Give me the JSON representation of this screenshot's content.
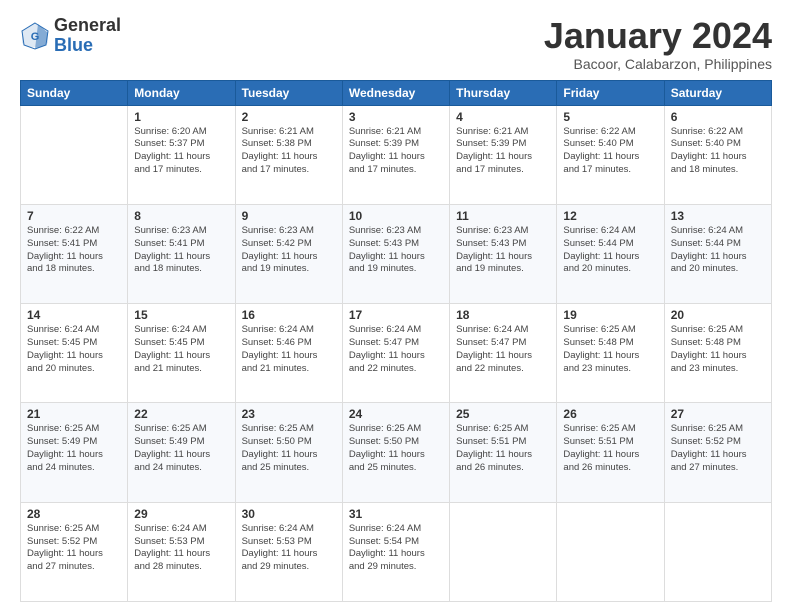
{
  "logo": {
    "general": "General",
    "blue": "Blue"
  },
  "title": "January 2024",
  "location": "Bacoor, Calabarzon, Philippines",
  "headers": [
    "Sunday",
    "Monday",
    "Tuesday",
    "Wednesday",
    "Thursday",
    "Friday",
    "Saturday"
  ],
  "weeks": [
    [
      {
        "day": "",
        "info": ""
      },
      {
        "day": "1",
        "info": "Sunrise: 6:20 AM\nSunset: 5:37 PM\nDaylight: 11 hours\nand 17 minutes."
      },
      {
        "day": "2",
        "info": "Sunrise: 6:21 AM\nSunset: 5:38 PM\nDaylight: 11 hours\nand 17 minutes."
      },
      {
        "day": "3",
        "info": "Sunrise: 6:21 AM\nSunset: 5:39 PM\nDaylight: 11 hours\nand 17 minutes."
      },
      {
        "day": "4",
        "info": "Sunrise: 6:21 AM\nSunset: 5:39 PM\nDaylight: 11 hours\nand 17 minutes."
      },
      {
        "day": "5",
        "info": "Sunrise: 6:22 AM\nSunset: 5:40 PM\nDaylight: 11 hours\nand 17 minutes."
      },
      {
        "day": "6",
        "info": "Sunrise: 6:22 AM\nSunset: 5:40 PM\nDaylight: 11 hours\nand 18 minutes."
      }
    ],
    [
      {
        "day": "7",
        "info": "Sunrise: 6:22 AM\nSunset: 5:41 PM\nDaylight: 11 hours\nand 18 minutes."
      },
      {
        "day": "8",
        "info": "Sunrise: 6:23 AM\nSunset: 5:41 PM\nDaylight: 11 hours\nand 18 minutes."
      },
      {
        "day": "9",
        "info": "Sunrise: 6:23 AM\nSunset: 5:42 PM\nDaylight: 11 hours\nand 19 minutes."
      },
      {
        "day": "10",
        "info": "Sunrise: 6:23 AM\nSunset: 5:43 PM\nDaylight: 11 hours\nand 19 minutes."
      },
      {
        "day": "11",
        "info": "Sunrise: 6:23 AM\nSunset: 5:43 PM\nDaylight: 11 hours\nand 19 minutes."
      },
      {
        "day": "12",
        "info": "Sunrise: 6:24 AM\nSunset: 5:44 PM\nDaylight: 11 hours\nand 20 minutes."
      },
      {
        "day": "13",
        "info": "Sunrise: 6:24 AM\nSunset: 5:44 PM\nDaylight: 11 hours\nand 20 minutes."
      }
    ],
    [
      {
        "day": "14",
        "info": "Sunrise: 6:24 AM\nSunset: 5:45 PM\nDaylight: 11 hours\nand 20 minutes."
      },
      {
        "day": "15",
        "info": "Sunrise: 6:24 AM\nSunset: 5:45 PM\nDaylight: 11 hours\nand 21 minutes."
      },
      {
        "day": "16",
        "info": "Sunrise: 6:24 AM\nSunset: 5:46 PM\nDaylight: 11 hours\nand 21 minutes."
      },
      {
        "day": "17",
        "info": "Sunrise: 6:24 AM\nSunset: 5:47 PM\nDaylight: 11 hours\nand 22 minutes."
      },
      {
        "day": "18",
        "info": "Sunrise: 6:24 AM\nSunset: 5:47 PM\nDaylight: 11 hours\nand 22 minutes."
      },
      {
        "day": "19",
        "info": "Sunrise: 6:25 AM\nSunset: 5:48 PM\nDaylight: 11 hours\nand 23 minutes."
      },
      {
        "day": "20",
        "info": "Sunrise: 6:25 AM\nSunset: 5:48 PM\nDaylight: 11 hours\nand 23 minutes."
      }
    ],
    [
      {
        "day": "21",
        "info": "Sunrise: 6:25 AM\nSunset: 5:49 PM\nDaylight: 11 hours\nand 24 minutes."
      },
      {
        "day": "22",
        "info": "Sunrise: 6:25 AM\nSunset: 5:49 PM\nDaylight: 11 hours\nand 24 minutes."
      },
      {
        "day": "23",
        "info": "Sunrise: 6:25 AM\nSunset: 5:50 PM\nDaylight: 11 hours\nand 25 minutes."
      },
      {
        "day": "24",
        "info": "Sunrise: 6:25 AM\nSunset: 5:50 PM\nDaylight: 11 hours\nand 25 minutes."
      },
      {
        "day": "25",
        "info": "Sunrise: 6:25 AM\nSunset: 5:51 PM\nDaylight: 11 hours\nand 26 minutes."
      },
      {
        "day": "26",
        "info": "Sunrise: 6:25 AM\nSunset: 5:51 PM\nDaylight: 11 hours\nand 26 minutes."
      },
      {
        "day": "27",
        "info": "Sunrise: 6:25 AM\nSunset: 5:52 PM\nDaylight: 11 hours\nand 27 minutes."
      }
    ],
    [
      {
        "day": "28",
        "info": "Sunrise: 6:25 AM\nSunset: 5:52 PM\nDaylight: 11 hours\nand 27 minutes."
      },
      {
        "day": "29",
        "info": "Sunrise: 6:24 AM\nSunset: 5:53 PM\nDaylight: 11 hours\nand 28 minutes."
      },
      {
        "day": "30",
        "info": "Sunrise: 6:24 AM\nSunset: 5:53 PM\nDaylight: 11 hours\nand 29 minutes."
      },
      {
        "day": "31",
        "info": "Sunrise: 6:24 AM\nSunset: 5:54 PM\nDaylight: 11 hours\nand 29 minutes."
      },
      {
        "day": "",
        "info": ""
      },
      {
        "day": "",
        "info": ""
      },
      {
        "day": "",
        "info": ""
      }
    ]
  ]
}
